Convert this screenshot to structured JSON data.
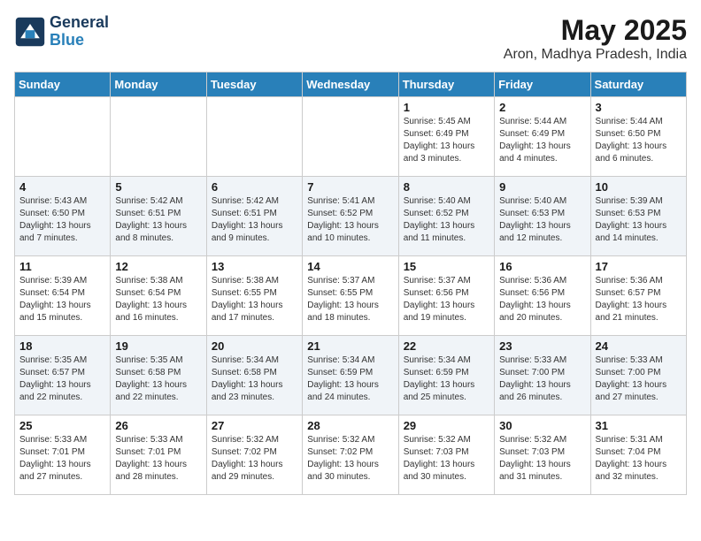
{
  "header": {
    "logo_line1": "General",
    "logo_line2": "Blue",
    "month": "May 2025",
    "location": "Aron, Madhya Pradesh, India"
  },
  "weekdays": [
    "Sunday",
    "Monday",
    "Tuesday",
    "Wednesday",
    "Thursday",
    "Friday",
    "Saturday"
  ],
  "weeks": [
    [
      {
        "day": "",
        "text": ""
      },
      {
        "day": "",
        "text": ""
      },
      {
        "day": "",
        "text": ""
      },
      {
        "day": "",
        "text": ""
      },
      {
        "day": "1",
        "text": "Sunrise: 5:45 AM\nSunset: 6:49 PM\nDaylight: 13 hours\nand 3 minutes."
      },
      {
        "day": "2",
        "text": "Sunrise: 5:44 AM\nSunset: 6:49 PM\nDaylight: 13 hours\nand 4 minutes."
      },
      {
        "day": "3",
        "text": "Sunrise: 5:44 AM\nSunset: 6:50 PM\nDaylight: 13 hours\nand 6 minutes."
      }
    ],
    [
      {
        "day": "4",
        "text": "Sunrise: 5:43 AM\nSunset: 6:50 PM\nDaylight: 13 hours\nand 7 minutes."
      },
      {
        "day": "5",
        "text": "Sunrise: 5:42 AM\nSunset: 6:51 PM\nDaylight: 13 hours\nand 8 minutes."
      },
      {
        "day": "6",
        "text": "Sunrise: 5:42 AM\nSunset: 6:51 PM\nDaylight: 13 hours\nand 9 minutes."
      },
      {
        "day": "7",
        "text": "Sunrise: 5:41 AM\nSunset: 6:52 PM\nDaylight: 13 hours\nand 10 minutes."
      },
      {
        "day": "8",
        "text": "Sunrise: 5:40 AM\nSunset: 6:52 PM\nDaylight: 13 hours\nand 11 minutes."
      },
      {
        "day": "9",
        "text": "Sunrise: 5:40 AM\nSunset: 6:53 PM\nDaylight: 13 hours\nand 12 minutes."
      },
      {
        "day": "10",
        "text": "Sunrise: 5:39 AM\nSunset: 6:53 PM\nDaylight: 13 hours\nand 14 minutes."
      }
    ],
    [
      {
        "day": "11",
        "text": "Sunrise: 5:39 AM\nSunset: 6:54 PM\nDaylight: 13 hours\nand 15 minutes."
      },
      {
        "day": "12",
        "text": "Sunrise: 5:38 AM\nSunset: 6:54 PM\nDaylight: 13 hours\nand 16 minutes."
      },
      {
        "day": "13",
        "text": "Sunrise: 5:38 AM\nSunset: 6:55 PM\nDaylight: 13 hours\nand 17 minutes."
      },
      {
        "day": "14",
        "text": "Sunrise: 5:37 AM\nSunset: 6:55 PM\nDaylight: 13 hours\nand 18 minutes."
      },
      {
        "day": "15",
        "text": "Sunrise: 5:37 AM\nSunset: 6:56 PM\nDaylight: 13 hours\nand 19 minutes."
      },
      {
        "day": "16",
        "text": "Sunrise: 5:36 AM\nSunset: 6:56 PM\nDaylight: 13 hours\nand 20 minutes."
      },
      {
        "day": "17",
        "text": "Sunrise: 5:36 AM\nSunset: 6:57 PM\nDaylight: 13 hours\nand 21 minutes."
      }
    ],
    [
      {
        "day": "18",
        "text": "Sunrise: 5:35 AM\nSunset: 6:57 PM\nDaylight: 13 hours\nand 22 minutes."
      },
      {
        "day": "19",
        "text": "Sunrise: 5:35 AM\nSunset: 6:58 PM\nDaylight: 13 hours\nand 22 minutes."
      },
      {
        "day": "20",
        "text": "Sunrise: 5:34 AM\nSunset: 6:58 PM\nDaylight: 13 hours\nand 23 minutes."
      },
      {
        "day": "21",
        "text": "Sunrise: 5:34 AM\nSunset: 6:59 PM\nDaylight: 13 hours\nand 24 minutes."
      },
      {
        "day": "22",
        "text": "Sunrise: 5:34 AM\nSunset: 6:59 PM\nDaylight: 13 hours\nand 25 minutes."
      },
      {
        "day": "23",
        "text": "Sunrise: 5:33 AM\nSunset: 7:00 PM\nDaylight: 13 hours\nand 26 minutes."
      },
      {
        "day": "24",
        "text": "Sunrise: 5:33 AM\nSunset: 7:00 PM\nDaylight: 13 hours\nand 27 minutes."
      }
    ],
    [
      {
        "day": "25",
        "text": "Sunrise: 5:33 AM\nSunset: 7:01 PM\nDaylight: 13 hours\nand 27 minutes."
      },
      {
        "day": "26",
        "text": "Sunrise: 5:33 AM\nSunset: 7:01 PM\nDaylight: 13 hours\nand 28 minutes."
      },
      {
        "day": "27",
        "text": "Sunrise: 5:32 AM\nSunset: 7:02 PM\nDaylight: 13 hours\nand 29 minutes."
      },
      {
        "day": "28",
        "text": "Sunrise: 5:32 AM\nSunset: 7:02 PM\nDaylight: 13 hours\nand 30 minutes."
      },
      {
        "day": "29",
        "text": "Sunrise: 5:32 AM\nSunset: 7:03 PM\nDaylight: 13 hours\nand 30 minutes."
      },
      {
        "day": "30",
        "text": "Sunrise: 5:32 AM\nSunset: 7:03 PM\nDaylight: 13 hours\nand 31 minutes."
      },
      {
        "day": "31",
        "text": "Sunrise: 5:31 AM\nSunset: 7:04 PM\nDaylight: 13 hours\nand 32 minutes."
      }
    ]
  ]
}
